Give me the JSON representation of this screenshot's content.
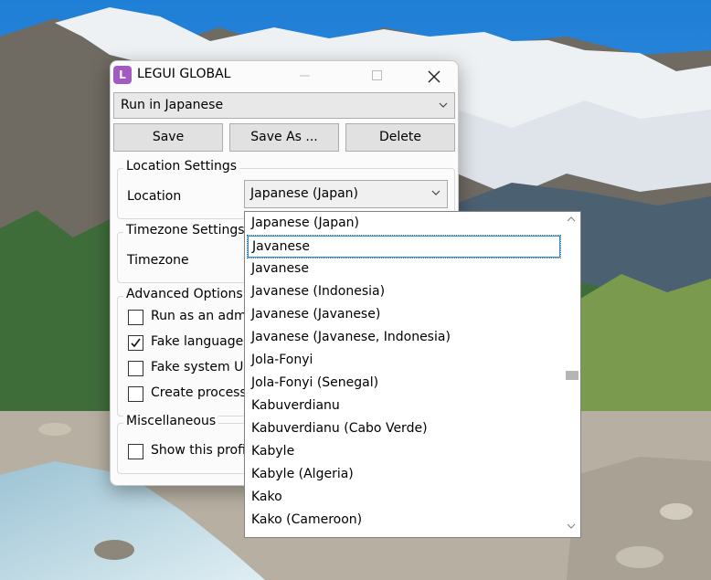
{
  "window": {
    "app_icon_letter": "L",
    "title": "LEGUI GLOBAL",
    "minimize_label": "Minimize",
    "maximize_label": "Maximize",
    "close_label": "Close"
  },
  "profile": {
    "selected": "Run in Japanese"
  },
  "actions": {
    "save": "Save",
    "save_as": "Save As ...",
    "delete": "Delete"
  },
  "location_settings": {
    "title": "Location Settings",
    "location_label": "Location",
    "location_value": "Japanese (Japan)"
  },
  "timezone_settings": {
    "title": "Timezone Settings",
    "timezone_label": "Timezone"
  },
  "advanced_options": {
    "title": "Advanced Options",
    "items": [
      {
        "label": "Run as an admi",
        "checked": false
      },
      {
        "label": "Fake language-",
        "checked": true
      },
      {
        "label": "Fake system UI",
        "checked": false
      },
      {
        "label": "Create process",
        "checked": false
      }
    ]
  },
  "miscellaneous": {
    "title": "Miscellaneous",
    "items": [
      {
        "label": "Show this profil",
        "checked": false
      }
    ]
  },
  "dropdown": {
    "items": [
      "Japanese (Japan)",
      "Javanese",
      "Javanese",
      "Javanese (Indonesia)",
      "Javanese (Javanese)",
      "Javanese (Javanese, Indonesia)",
      "Jola-Fonyi",
      "Jola-Fonyi (Senegal)",
      "Kabuverdianu",
      "Kabuverdianu (Cabo Verde)",
      "Kabyle",
      "Kabyle (Algeria)",
      "Kako",
      "Kako (Cameroon)"
    ],
    "focused_index": 1
  },
  "colors": {
    "app_icon": "#a25bc2",
    "focus": "#2f8fd0",
    "window_bg": "#fbfbfb"
  }
}
